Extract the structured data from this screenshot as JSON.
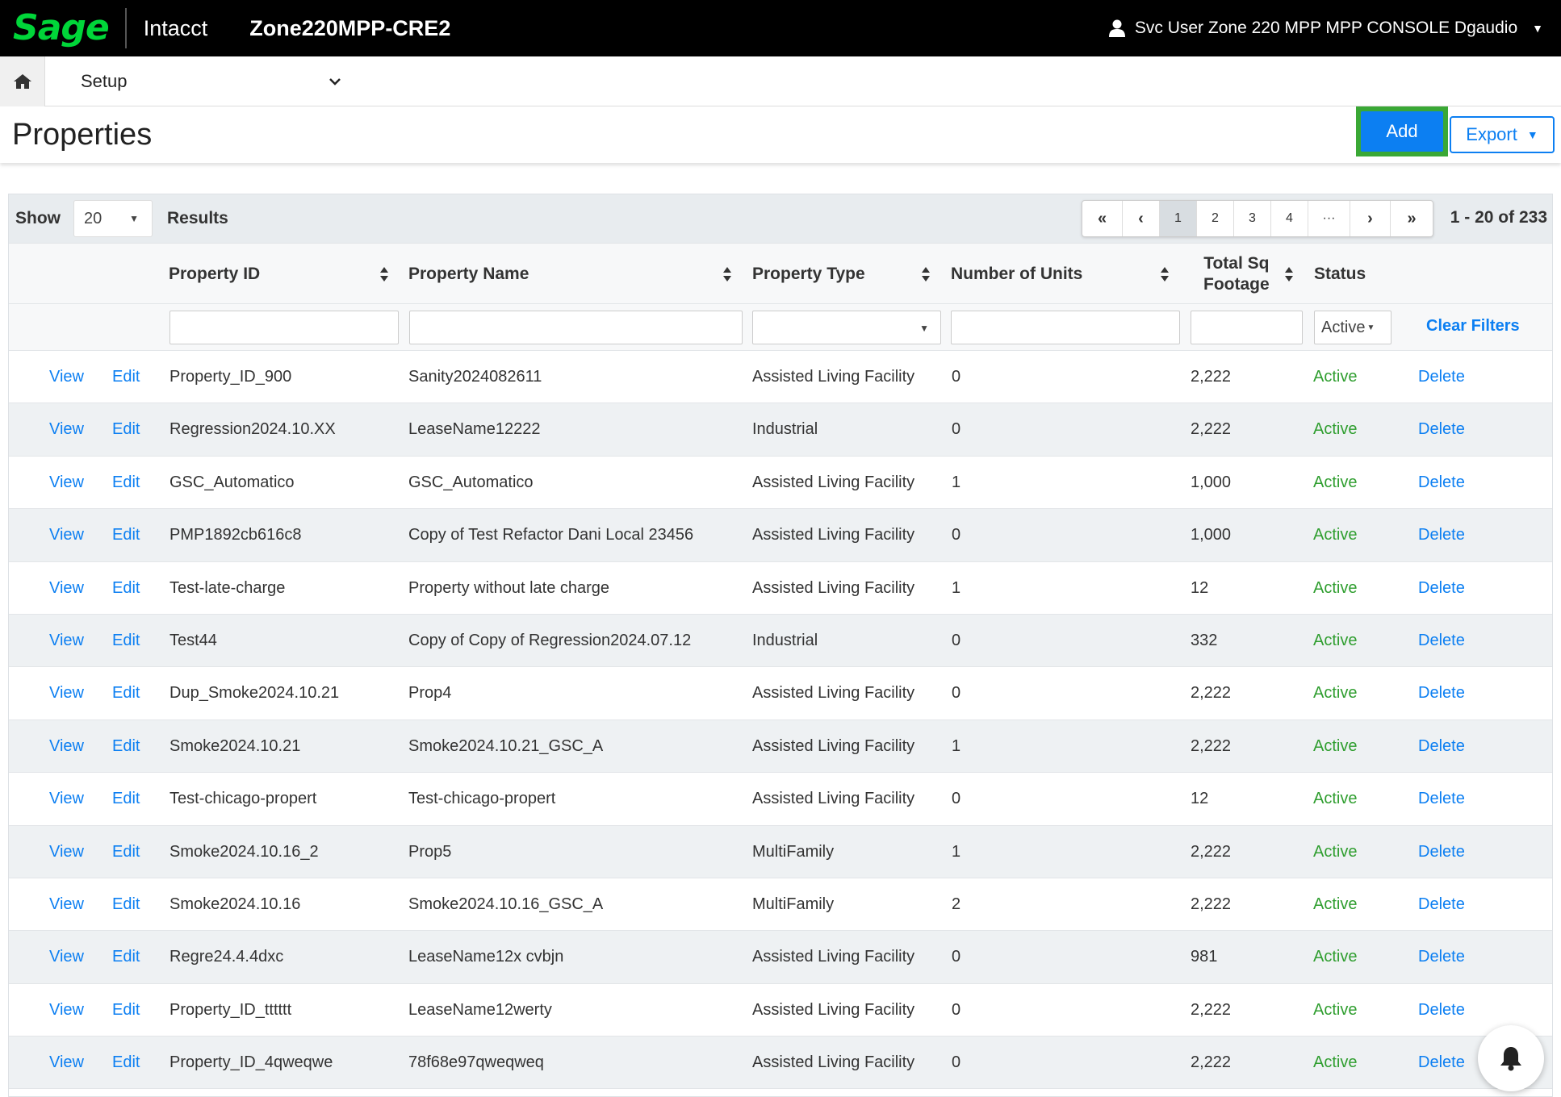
{
  "app": {
    "logo": "Sage",
    "product": "Intacct",
    "company": "Zone220MPP-CRE2",
    "user": "Svc User Zone 220 MPP MPP CONSOLE Dgaudio"
  },
  "nav": {
    "module": "Setup"
  },
  "page": {
    "title": "Properties",
    "add_label": "Add",
    "export_label": "Export"
  },
  "toolbar": {
    "show_label": "Show",
    "page_size": "20",
    "results_label": "Results",
    "pagination": [
      "«",
      "‹",
      "1",
      "2",
      "3",
      "4",
      "···",
      "›",
      "»"
    ],
    "active_page": "1",
    "range": "1 - 20 of 233"
  },
  "columns": {
    "property_id": "Property ID",
    "property_name": "Property Name",
    "property_type": "Property Type",
    "units": "Number of Units",
    "sqft_line1": "Total Sq",
    "sqft_line2": "Footage",
    "status": "Status"
  },
  "filters": {
    "status_value": "Active",
    "clear_label": "Clear Filters"
  },
  "row_actions": {
    "view": "View",
    "edit": "Edit",
    "delete": "Delete"
  },
  "rows": [
    {
      "id": "Property_ID_900",
      "name": "Sanity2024082611",
      "type": "Assisted Living Facility",
      "units": "0",
      "sqft": "2,222",
      "status": "Active"
    },
    {
      "id": "Regression2024.10.XX",
      "name": "LeaseName12222",
      "type": "Industrial",
      "units": "0",
      "sqft": "2,222",
      "status": "Active"
    },
    {
      "id": "GSC_Automatico",
      "name": "GSC_Automatico",
      "type": "Assisted Living Facility",
      "units": "1",
      "sqft": "1,000",
      "status": "Active"
    },
    {
      "id": "PMP1892cb616c8",
      "name": "Copy of Test Refactor Dani Local 23456",
      "type": "Assisted Living Facility",
      "units": "0",
      "sqft": "1,000",
      "status": "Active"
    },
    {
      "id": "Test-late-charge",
      "name": "Property without late charge",
      "type": "Assisted Living Facility",
      "units": "1",
      "sqft": "12",
      "status": "Active"
    },
    {
      "id": "Test44",
      "name": "Copy of Copy of Regression2024.07.12",
      "type": "Industrial",
      "units": "0",
      "sqft": "332",
      "status": "Active"
    },
    {
      "id": "Dup_Smoke2024.10.21",
      "name": "Prop4",
      "type": "Assisted Living Facility",
      "units": "0",
      "sqft": "2,222",
      "status": "Active"
    },
    {
      "id": "Smoke2024.10.21",
      "name": "Smoke2024.10.21_GSC_A",
      "type": "Assisted Living Facility",
      "units": "1",
      "sqft": "2,222",
      "status": "Active"
    },
    {
      "id": "Test-chicago-propert",
      "name": "Test-chicago-propert",
      "type": "Assisted Living Facility",
      "units": "0",
      "sqft": "12",
      "status": "Active"
    },
    {
      "id": "Smoke2024.10.16_2",
      "name": "Prop5",
      "type": "MultiFamily",
      "units": "1",
      "sqft": "2,222",
      "status": "Active"
    },
    {
      "id": "Smoke2024.10.16",
      "name": "Smoke2024.10.16_GSC_A",
      "type": "MultiFamily",
      "units": "2",
      "sqft": "2,222",
      "status": "Active"
    },
    {
      "id": "Regre24.4.4dxc",
      "name": "LeaseName12x cvbjn",
      "type": "Assisted Living Facility",
      "units": "0",
      "sqft": "981",
      "status": "Active"
    },
    {
      "id": "Property_ID_tttttt",
      "name": "LeaseName12werty",
      "type": "Assisted Living Facility",
      "units": "0",
      "sqft": "2,222",
      "status": "Active"
    },
    {
      "id": "Property_ID_4qweqwe",
      "name": "78f68e97qweqweq",
      "type": "Assisted Living Facility",
      "units": "0",
      "sqft": "2,222",
      "status": "Active"
    }
  ],
  "colors": {
    "topbar": "#000000",
    "brand": "#00d639",
    "primary": "#0c7ff2",
    "active_status": "#2f9e2f",
    "add_highlight": "#3aa835"
  },
  "icons": {
    "user": "user-icon",
    "home": "home-icon",
    "bell": "bell-icon",
    "sort": "sort-icon"
  }
}
